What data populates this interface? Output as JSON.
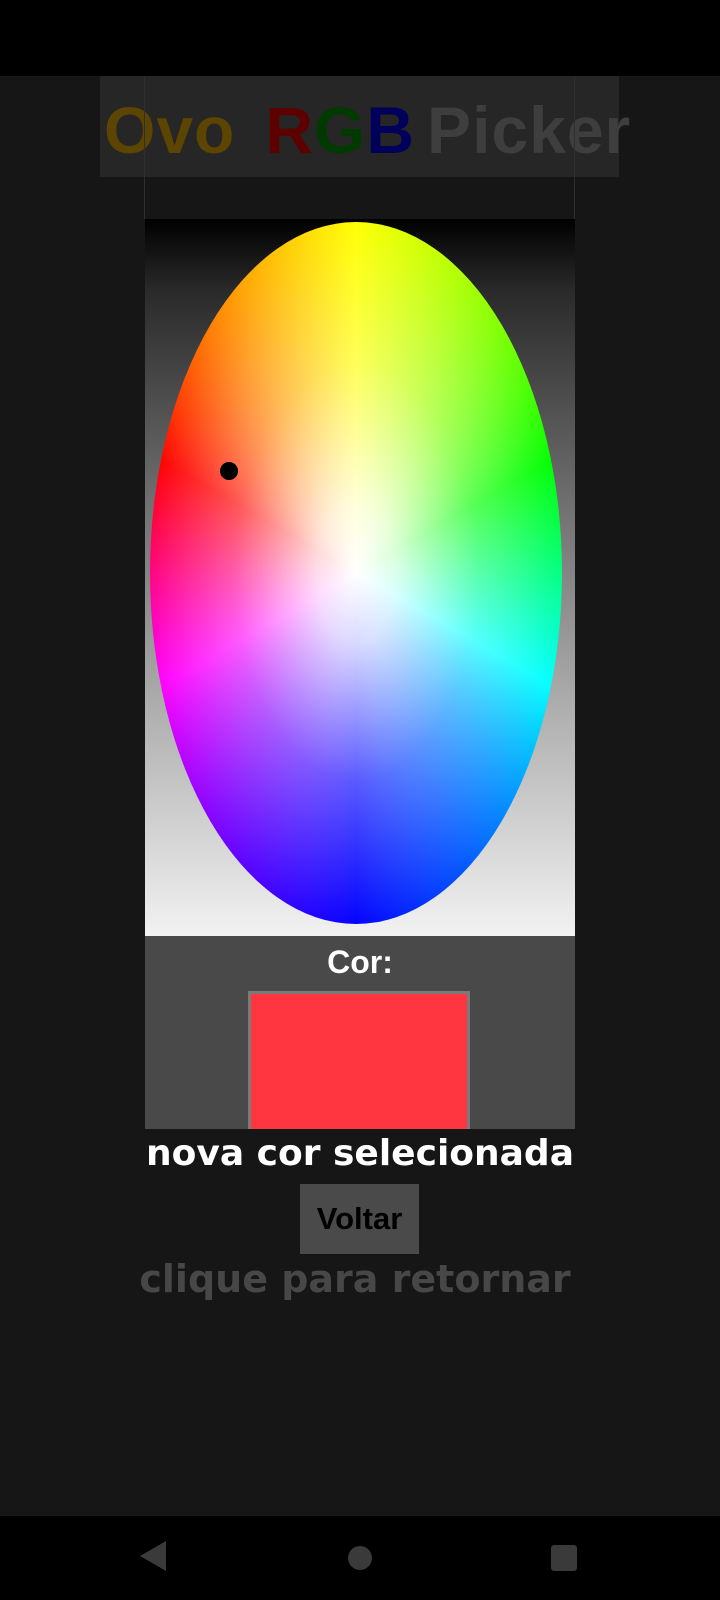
{
  "app": {
    "title": {
      "ovo": "Ovo",
      "r": "R",
      "g": "G",
      "b": "B",
      "picker": "Picker"
    }
  },
  "color_picker": {
    "marker_color": "#000000"
  },
  "selected_color": {
    "label": "Cor:",
    "swatch_color": "#ff3540"
  },
  "toast": {
    "message": "nova cor selecionada"
  },
  "back_button": {
    "label": "Voltar"
  },
  "hint": {
    "text": "clique para retornar"
  },
  "navigation_bar": {
    "icons": [
      "back-icon",
      "home-icon",
      "recents-icon"
    ]
  }
}
